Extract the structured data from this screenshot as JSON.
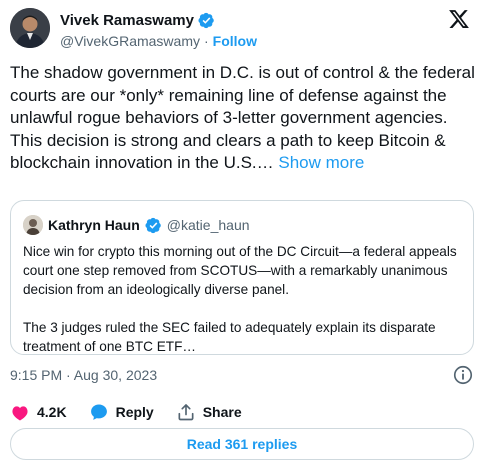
{
  "author": {
    "name": "Vivek Ramaswamy",
    "handle": "@VivekGRamaswamy",
    "separator": "·",
    "follow_label": "Follow"
  },
  "tweet": {
    "text": "The shadow government in D.C. is out of control & the federal courts are our *only* remaining line of defense against the unlawful rogue behaviors of 3-letter government agencies. This decision is strong and clears a path to keep Bitcoin & blockchain innovation in the U.S.…",
    "show_more_label": "Show more"
  },
  "quote": {
    "name": "Kathryn Haun",
    "handle": "@katie_haun",
    "paragraphs": [
      "Nice win for crypto this morning out of the DC Circuit—a federal appeals court one step removed from SCOTUS—with a remarkably unanimous decision from an ideologically diverse panel.",
      "The 3 judges ruled the SEC failed to adequately explain its disparate treatment of one BTC ETF…"
    ]
  },
  "meta": {
    "timestamp": "9:15 PM · Aug 30, 2023"
  },
  "actions": {
    "like_count": "4.2K",
    "reply_label": "Reply",
    "share_label": "Share"
  },
  "replies_button_label": "Read 361 replies",
  "colors": {
    "accent": "#1d9bf0",
    "like": "#f91880",
    "text": "#0f1419",
    "muted": "#536471",
    "border": "#cfd9de"
  },
  "icons": [
    "verified-badge-icon",
    "x-logo-icon",
    "info-icon",
    "heart-icon",
    "reply-bubble-icon",
    "share-icon"
  ]
}
